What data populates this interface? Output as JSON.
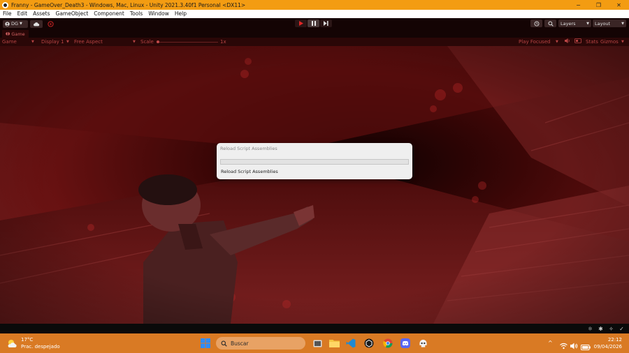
{
  "window": {
    "title": "Franny - GameOver_Death3 - Windows, Mac, Linux - Unity 2021.3.40f1 Personal <DX11>",
    "controls": {
      "minimize": "−",
      "maximize": "❐",
      "close": "✕"
    }
  },
  "menu": [
    "File",
    "Edit",
    "Assets",
    "GameObject",
    "Component",
    "Tools",
    "Window",
    "Help"
  ],
  "toolbar": {
    "account_label": "DG",
    "layers_label": "Layers",
    "layout_label": "Layout"
  },
  "game_tab": {
    "label": "Game"
  },
  "game_bar": {
    "view_label": "Game",
    "display_label": "Display 1",
    "aspect_label": "Free Aspect",
    "scale_label": "Scale",
    "scale_value": "1x",
    "play_focused_label": "Play Focused",
    "stats_label": "Stats",
    "gizmos_label": "Gizmos"
  },
  "dialog": {
    "title": "Reload Script Assemblies",
    "progress": 0.0,
    "status": "Reload Script Assemblies"
  },
  "taskbar": {
    "weather_temp": "17°C",
    "weather_desc": "Prac. despejado",
    "search_placeholder": "Buscar",
    "time": "22:12",
    "date": "09/04/2026"
  },
  "colors": {
    "title_bar": "#f39c12",
    "editor_dark": "#140404",
    "game_tint": "#2a0707",
    "taskbar": "#d97a24",
    "progress_fill": "#4a90d9"
  }
}
